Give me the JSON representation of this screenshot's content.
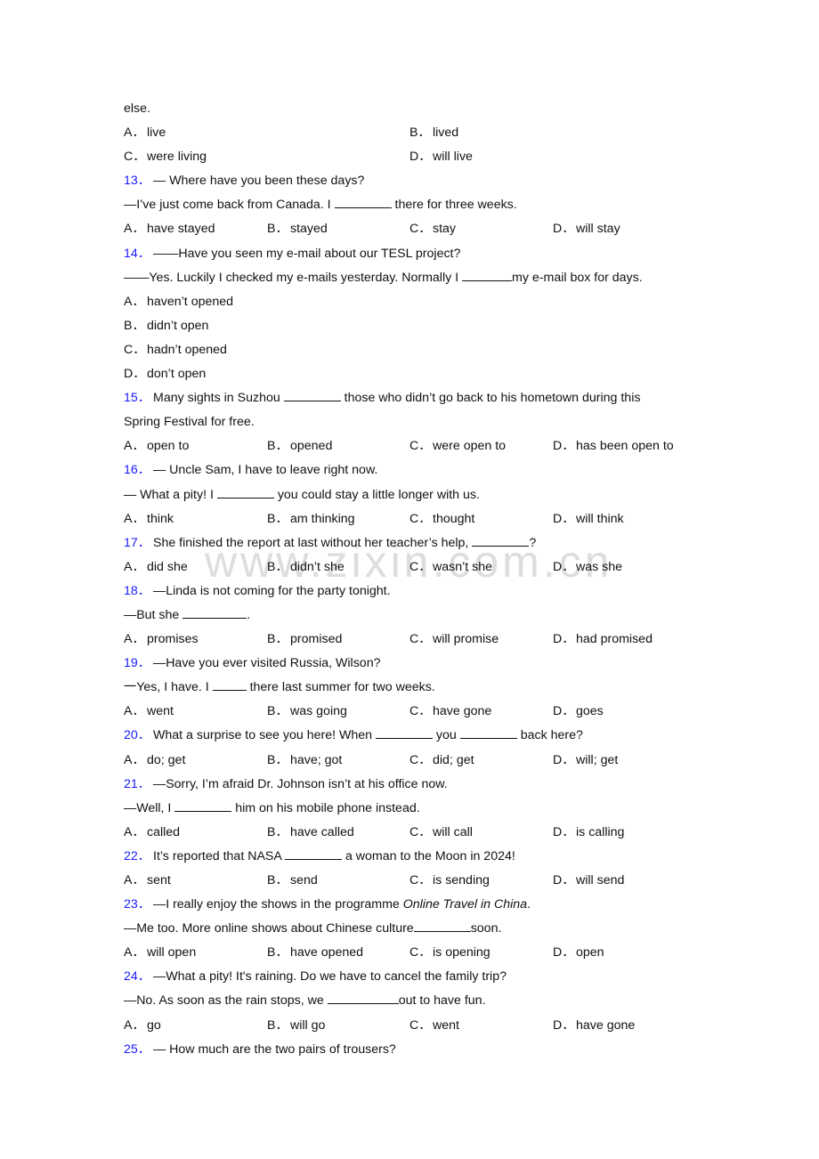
{
  "watermark": "www.zixin.com.cn",
  "q12": {
    "tail": "else.",
    "options": [
      {
        "label": "A．",
        "text": "live"
      },
      {
        "label": "B．",
        "text": "lived"
      },
      {
        "label": "C．",
        "text": "were living"
      },
      {
        "label": "D．",
        "text": "will live"
      }
    ]
  },
  "q13": {
    "num": "13．",
    "line1": "— Where have you been these days?",
    "line2a": "—I’ve just come back from Canada. I ",
    "line2b": " there for three weeks.",
    "options": [
      {
        "label": "A．",
        "text": "have stayed"
      },
      {
        "label": "B．",
        "text": "stayed"
      },
      {
        "label": "C．",
        "text": "stay"
      },
      {
        "label": "D．",
        "text": "will stay"
      }
    ]
  },
  "q14": {
    "num": "14．",
    "line1": "——Have you seen my e-mail about our TESL project?",
    "line2a": "——Yes. Luckily I checked my e-mails yesterday. Normally I ",
    "line2b": "my e-mail box for days.",
    "options": [
      {
        "label": "A．",
        "text": "haven’t opened"
      },
      {
        "label": "B．",
        "text": "didn’t open"
      },
      {
        "label": "C．",
        "text": "hadn’t opened"
      },
      {
        "label": "D．",
        "text": "don’t open"
      }
    ]
  },
  "q15": {
    "num": "15．",
    "line1a": "Many sights in Suzhou ",
    "line1b": " those who didn’t go back to his hometown during this",
    "line2": "Spring Festival for free.",
    "options": [
      {
        "label": "A．",
        "text": "open to"
      },
      {
        "label": "B．",
        "text": "opened"
      },
      {
        "label": "C．",
        "text": "were open to"
      },
      {
        "label": "D．",
        "text": "has been open to"
      }
    ]
  },
  "q16": {
    "num": "16．",
    "line1": "— Uncle Sam, I have to leave right now.",
    "line2a": "— What a pity! I ",
    "line2b": " you could stay a little longer with us.",
    "options": [
      {
        "label": "A．",
        "text": "think"
      },
      {
        "label": "B．",
        "text": "am thinking"
      },
      {
        "label": "C．",
        "text": "thought"
      },
      {
        "label": "D．",
        "text": "will think"
      }
    ]
  },
  "q17": {
    "num": "17．",
    "line1a": "She finished the report at last without her teacher’s help, ",
    "line1b": "?",
    "options": [
      {
        "label": "A．",
        "text": "did she"
      },
      {
        "label": "B．",
        "text": "didn’t she"
      },
      {
        "label": "C．",
        "text": "wasn’t she"
      },
      {
        "label": "D．",
        "text": "was she"
      }
    ]
  },
  "q18": {
    "num": "18．",
    "line1": "—Linda is not coming for the party tonight.",
    "line2a": "—But she ",
    "line2b": ".",
    "options": [
      {
        "label": "A．",
        "text": "promises"
      },
      {
        "label": "B．",
        "text": "promised"
      },
      {
        "label": "C．",
        "text": "will promise"
      },
      {
        "label": "D．",
        "text": "had promised"
      }
    ]
  },
  "q19": {
    "num": "19．",
    "line1": "—Have you ever visited Russia, Wilson?",
    "line2a": "一Yes, I have. I ",
    "line2b": " there last summer for two weeks.",
    "options": [
      {
        "label": "A．",
        "text": "went"
      },
      {
        "label": "B．",
        "text": "was going"
      },
      {
        "label": "C．",
        "text": "have gone"
      },
      {
        "label": "D．",
        "text": "goes"
      }
    ]
  },
  "q20": {
    "num": "20．",
    "line1a": "What a surprise to see you here! When ",
    "line1b": " you ",
    "line1c": " back here?",
    "options": [
      {
        "label": "A．",
        "text": "do; get"
      },
      {
        "label": "B．",
        "text": "have; got"
      },
      {
        "label": "C．",
        "text": "did; get"
      },
      {
        "label": "D．",
        "text": "will; get"
      }
    ]
  },
  "q21": {
    "num": "21．",
    "line1": "—Sorry, I’m afraid Dr. Johnson isn’t at his office now.",
    "line2a": "—Well, I ",
    "line2b": " him on his mobile phone instead.",
    "options": [
      {
        "label": "A．",
        "text": "called"
      },
      {
        "label": "B．",
        "text": "have called"
      },
      {
        "label": "C．",
        "text": "will call"
      },
      {
        "label": "D．",
        "text": "is calling"
      }
    ]
  },
  "q22": {
    "num": "22．",
    "line1a": "It’s reported that NASA ",
    "line1b": " a woman to the Moon in 2024!",
    "options": [
      {
        "label": "A．",
        "text": "sent"
      },
      {
        "label": "B．",
        "text": "send"
      },
      {
        "label": "C．",
        "text": "is sending"
      },
      {
        "label": "D．",
        "text": "will send"
      }
    ]
  },
  "q23": {
    "num": "23．",
    "line1a": "—I really enjoy the shows in the programme ",
    "line1i": "Online Travel in China",
    "line1b": ".",
    "line2a": "—Me too. More online shows about Chinese culture",
    "line2b": "soon.",
    "options": [
      {
        "label": "A．",
        "text": "will open"
      },
      {
        "label": "B．",
        "text": "have opened"
      },
      {
        "label": "C．",
        "text": "is opening"
      },
      {
        "label": "D．",
        "text": "open"
      }
    ]
  },
  "q24": {
    "num": "24．",
    "line1": "—What a pity! It's raining. Do we have to cancel the family trip?",
    "line2a": "—No. As soon as the rain stops, we ",
    "line2b": "out to have fun.",
    "options": [
      {
        "label": "A．",
        "text": "go"
      },
      {
        "label": "B．",
        "text": "will go"
      },
      {
        "label": "C．",
        "text": "went"
      },
      {
        "label": "D．",
        "text": "have gone"
      }
    ]
  },
  "q25": {
    "num": "25．",
    "line1": "— How much are the two pairs of trousers?"
  }
}
